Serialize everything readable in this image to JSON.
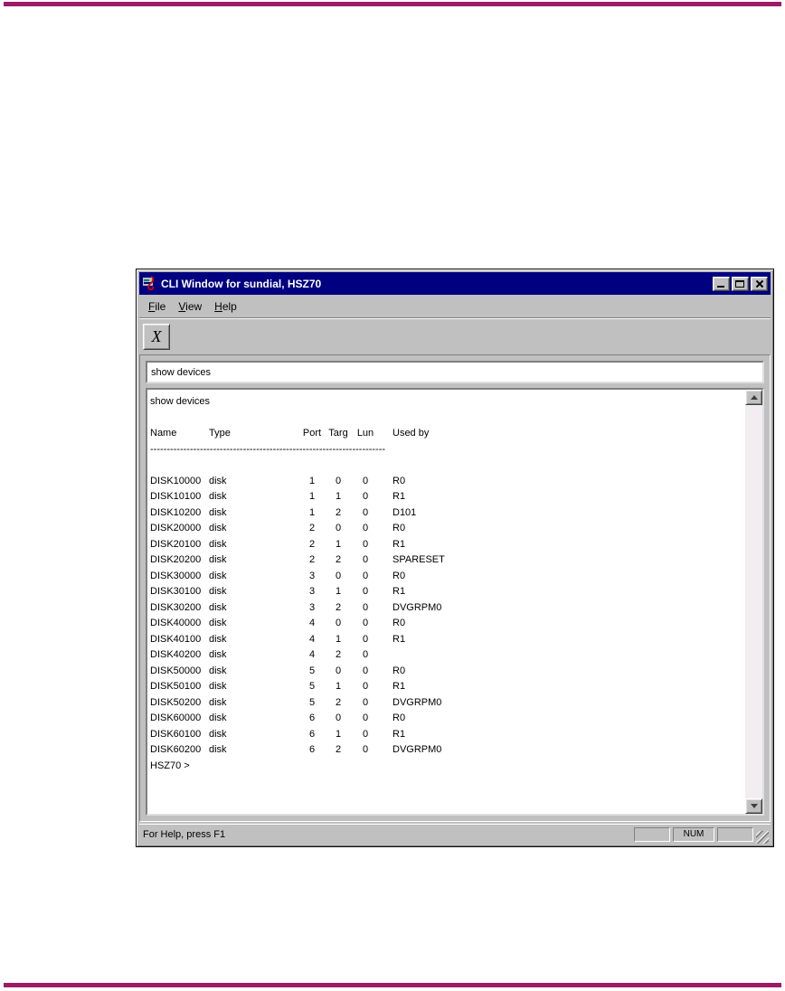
{
  "page": {
    "rule_color": "#9e1a66"
  },
  "window": {
    "title": "CLI Window for sundial, HSZ70",
    "titlebar_color": "#000080",
    "menu": {
      "items": [
        {
          "label": "File"
        },
        {
          "label": "View"
        },
        {
          "label": "Help"
        }
      ]
    },
    "toolbar": {
      "clear_button_glyph": "X"
    },
    "command_input": {
      "value": "show devices"
    },
    "terminal": {
      "echo": "show devices",
      "columns": [
        "Name",
        "Type",
        "Port",
        "Targ",
        "Lun",
        "Used by"
      ],
      "separator": "----------------------------------------------------------------------------------------------------",
      "rows": [
        [
          "DISK10000",
          "disk",
          "1",
          "0",
          "0",
          "R0"
        ],
        [
          "DISK10100",
          "disk",
          "1",
          "1",
          "0",
          "R1"
        ],
        [
          "DISK10200",
          "disk",
          "1",
          "2",
          "0",
          "D101"
        ],
        [
          "DISK20000",
          "disk",
          "2",
          "0",
          "0",
          "R0"
        ],
        [
          "DISK20100",
          "disk",
          "2",
          "1",
          "0",
          "R1"
        ],
        [
          "DISK20200",
          "disk",
          "2",
          "2",
          "0",
          "SPARESET"
        ],
        [
          "DISK30000",
          "disk",
          "3",
          "0",
          "0",
          "R0"
        ],
        [
          "DISK30100",
          "disk",
          "3",
          "1",
          "0",
          "R1"
        ],
        [
          "DISK30200",
          "disk",
          "3",
          "2",
          "0",
          "DVGRPM0"
        ],
        [
          "DISK40000",
          "disk",
          "4",
          "0",
          "0",
          "R0"
        ],
        [
          "DISK40100",
          "disk",
          "4",
          "1",
          "0",
          "R1"
        ],
        [
          "DISK40200",
          "disk",
          "4",
          "2",
          "0",
          ""
        ],
        [
          "DISK50000",
          "disk",
          "5",
          "0",
          "0",
          "R0"
        ],
        [
          "DISK50100",
          "disk",
          "5",
          "1",
          "0",
          "R1"
        ],
        [
          "DISK50200",
          "disk",
          "5",
          "2",
          "0",
          "DVGRPM0"
        ],
        [
          "DISK60000",
          "disk",
          "6",
          "0",
          "0",
          "R0"
        ],
        [
          "DISK60100",
          "disk",
          "6",
          "1",
          "0",
          "R1"
        ],
        [
          "DISK60200",
          "disk",
          "6",
          "2",
          "0",
          "DVGRPM0"
        ]
      ],
      "prompt": "HSZ70 >"
    },
    "statusbar": {
      "message": "For Help, press F1",
      "num_label": "NUM"
    }
  }
}
